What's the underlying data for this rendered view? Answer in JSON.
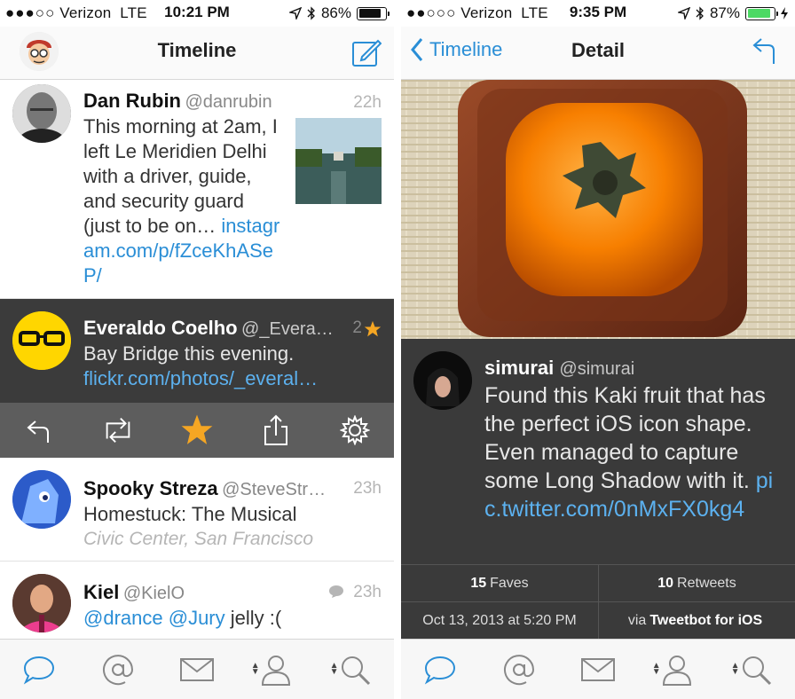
{
  "left": {
    "status": {
      "signal": "●●●○○",
      "carrier": "Verizon",
      "network": "LTE",
      "time": "10:21 PM",
      "battery": "86%",
      "battery_level": 0.86
    },
    "nav": {
      "title": "Timeline"
    },
    "tweets": [
      {
        "name": "Dan Rubin",
        "handle": "@danrubin",
        "time": "22h",
        "text": "This morning at 2am, I left Le Meridien Delhi with a driver, guide, and security guard (just to be on… ",
        "link": "instagram.com/p/fZceKhASeP/"
      },
      {
        "name": "Everaldo Coelho",
        "handle": "@_Evera…",
        "time": "2",
        "text": "Bay Bridge this evening.",
        "link": "flickr.com/photos/_everal…"
      },
      {
        "name": "Spooky Streza",
        "handle": "@SteveStr…",
        "time": "23h",
        "text": "Homestuck: The Musical",
        "location": "Civic Center, San Francisco"
      },
      {
        "name": "Kiel",
        "handle": "@KielO",
        "time": "23h",
        "mention1": "@drance",
        "mention2": "@Jury",
        "text": "jelly :("
      }
    ],
    "actions": [
      "reply-icon",
      "retweet-icon",
      "star-icon",
      "share-icon",
      "gear-icon"
    ],
    "tabs": [
      "timeline",
      "mentions",
      "messages",
      "profile",
      "search"
    ]
  },
  "right": {
    "status": {
      "signal": "●●○○○",
      "carrier": "Verizon",
      "network": "LTE",
      "time": "9:35 PM",
      "battery": "87%",
      "battery_level": 0.87
    },
    "nav": {
      "back": "Timeline",
      "title": "Detail"
    },
    "tweet": {
      "name": "simurai",
      "handle": "@simurai",
      "text": "Found this Kaki fruit that has the perfect iOS icon shape. Even managed to capture some Long Shadow with it. ",
      "link": "pic.twitter.com/0nMxFX0kg4"
    },
    "stats": {
      "faves_count": "15",
      "faves_label": "Faves",
      "retweets_count": "10",
      "retweets_label": "Retweets",
      "date": "Oct 13, 2013 at 5:20 PM",
      "via_label": "via",
      "via_app": "Tweetbot for iOS"
    }
  },
  "colors": {
    "accent": "#2a8ed6",
    "dark_cell": "#3b3b3b",
    "action_bar": "#5d5d5d",
    "star": "#f5a623"
  }
}
